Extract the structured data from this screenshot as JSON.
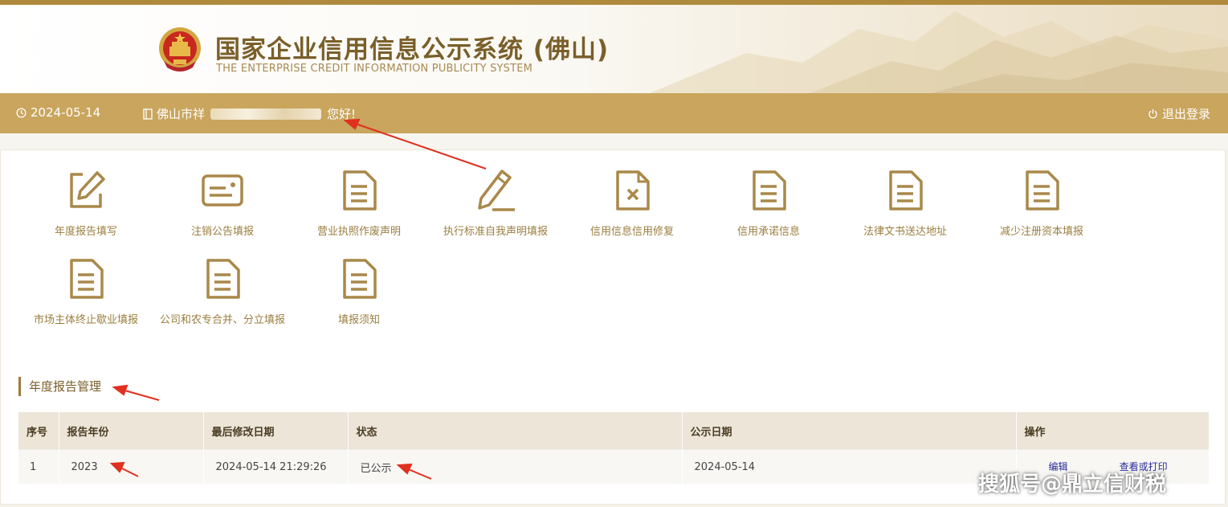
{
  "header": {
    "title_cn": "国家企业信用信息公示系统 (佛山)",
    "title_en": "THE ENTERPRISE CREDIT INFORMATION PUBLICITY SYSTEM"
  },
  "infobar": {
    "date": "2024-05-14",
    "user_prefix": "佛山市祥",
    "user_suffix": "您好!",
    "logout_label": "退出登录"
  },
  "functions": [
    {
      "label": "年度报告填写",
      "icon": "edit-icon"
    },
    {
      "label": "注销公告填报",
      "icon": "card-icon"
    },
    {
      "label": "营业执照作废声明",
      "icon": "document-icon"
    },
    {
      "label": "执行标准自我声明填报",
      "icon": "pencil-icon"
    },
    {
      "label": "信用信息信用修复",
      "icon": "document-x-icon"
    },
    {
      "label": "信用承诺信息",
      "icon": "document-icon"
    },
    {
      "label": "法律文书送达地址",
      "icon": "document-icon"
    },
    {
      "label": "减少注册资本填报",
      "icon": "document-icon"
    },
    {
      "label": "市场主体终止歇业填报",
      "icon": "document-icon"
    },
    {
      "label": "公司和农专合并、分立填报",
      "icon": "document-icon"
    },
    {
      "label": "填报须知",
      "icon": "document-icon"
    }
  ],
  "section": {
    "title": "年度报告管理"
  },
  "table": {
    "headers": [
      "序号",
      "报告年份",
      "最后修改日期",
      "状态",
      "公示日期",
      "操作"
    ],
    "rows": [
      {
        "index": "1",
        "year": "2023",
        "modified": "2024-05-14 21:29:26",
        "status": "已公示",
        "publish_date": "2024-05-14",
        "action_edit": "编辑",
        "action_view": "查看或打印"
      }
    ]
  },
  "watermark": "搜狐号@鼎立信财税",
  "colors": {
    "brand_gold": "#c9a55d",
    "icon_gold": "#a9884a",
    "annotation_red": "#e0301e"
  }
}
